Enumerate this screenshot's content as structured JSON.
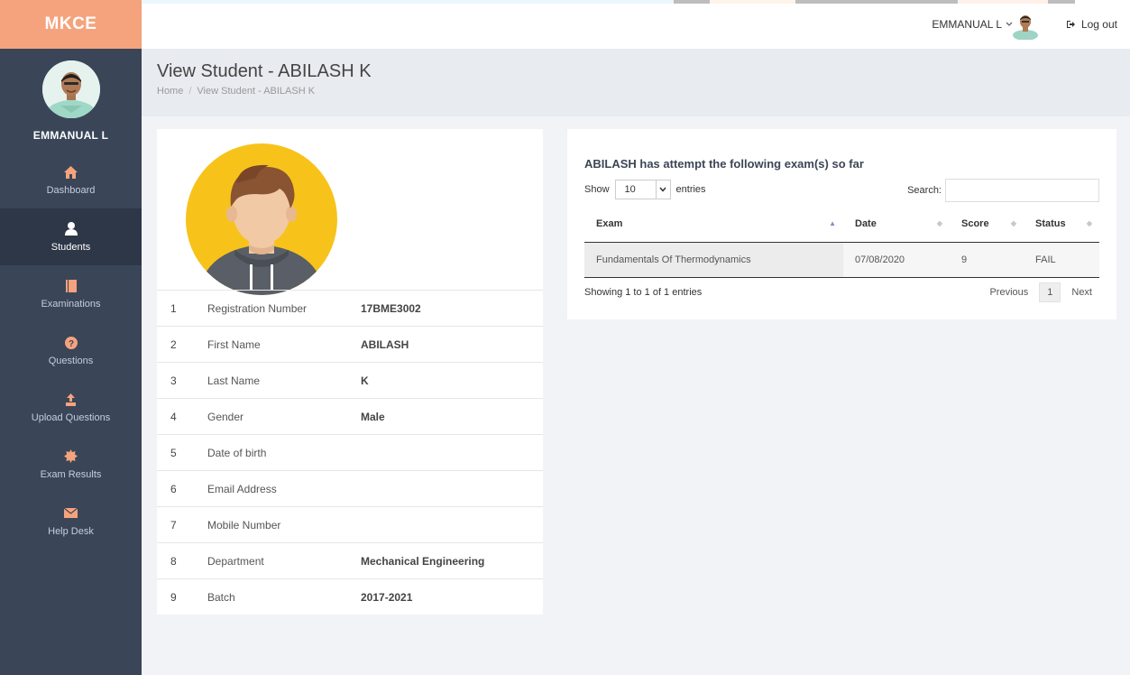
{
  "app": {
    "brand": "MKCE"
  },
  "header": {
    "user_name": "EMMANUAL L",
    "logout_label": "Log out"
  },
  "sidebar": {
    "profile_name": "EMMANUAL L",
    "items": [
      {
        "label": "Dashboard",
        "icon": "home-icon",
        "active": false
      },
      {
        "label": "Students",
        "icon": "user-icon",
        "active": true
      },
      {
        "label": "Examinations",
        "icon": "book-icon",
        "active": false
      },
      {
        "label": "Questions",
        "icon": "question-icon",
        "active": false
      },
      {
        "label": "Upload Questions",
        "icon": "upload-icon",
        "active": false
      },
      {
        "label": "Exam Results",
        "icon": "certificate-icon",
        "active": false
      },
      {
        "label": "Help Desk",
        "icon": "envelope-icon",
        "active": false
      }
    ]
  },
  "page": {
    "title": "View Student - ABILASH K",
    "breadcrumb": {
      "home": "Home",
      "current": "View Student - ABILASH K"
    }
  },
  "student": {
    "fields": [
      {
        "num": "1",
        "label": "Registration Number",
        "value": "17BME3002"
      },
      {
        "num": "2",
        "label": "First Name",
        "value": "ABILASH"
      },
      {
        "num": "3",
        "label": "Last Name",
        "value": "K"
      },
      {
        "num": "4",
        "label": "Gender",
        "value": "Male"
      },
      {
        "num": "5",
        "label": "Date of birth",
        "value": ""
      },
      {
        "num": "6",
        "label": "Email Address",
        "value": ""
      },
      {
        "num": "7",
        "label": "Mobile Number",
        "value": ""
      },
      {
        "num": "8",
        "label": "Department",
        "value": "Mechanical Engineering"
      },
      {
        "num": "9",
        "label": "Batch",
        "value": "2017-2021"
      }
    ]
  },
  "exams": {
    "title": "ABILASH has attempt the following exam(s) so far",
    "show_label": "Show",
    "entries_value": "10",
    "entries_label": "entries",
    "search_label": "Search:",
    "search_value": "",
    "columns": [
      "Exam",
      "Date",
      "Score",
      "Status"
    ],
    "rows": [
      {
        "exam": "Fundamentals Of Thermodynamics",
        "date": "07/08/2020",
        "score": "9",
        "status": "FAIL"
      }
    ],
    "info": "Showing 1 to 1 of 1 entries",
    "pager": {
      "previous": "Previous",
      "current": "1",
      "next": "Next"
    }
  },
  "colors": {
    "brand_bg": "#f5a37d",
    "sidebar_bg": "#3a4558",
    "sidebar_active": "#2e3748",
    "avatar_bg": "#f7c31b"
  }
}
